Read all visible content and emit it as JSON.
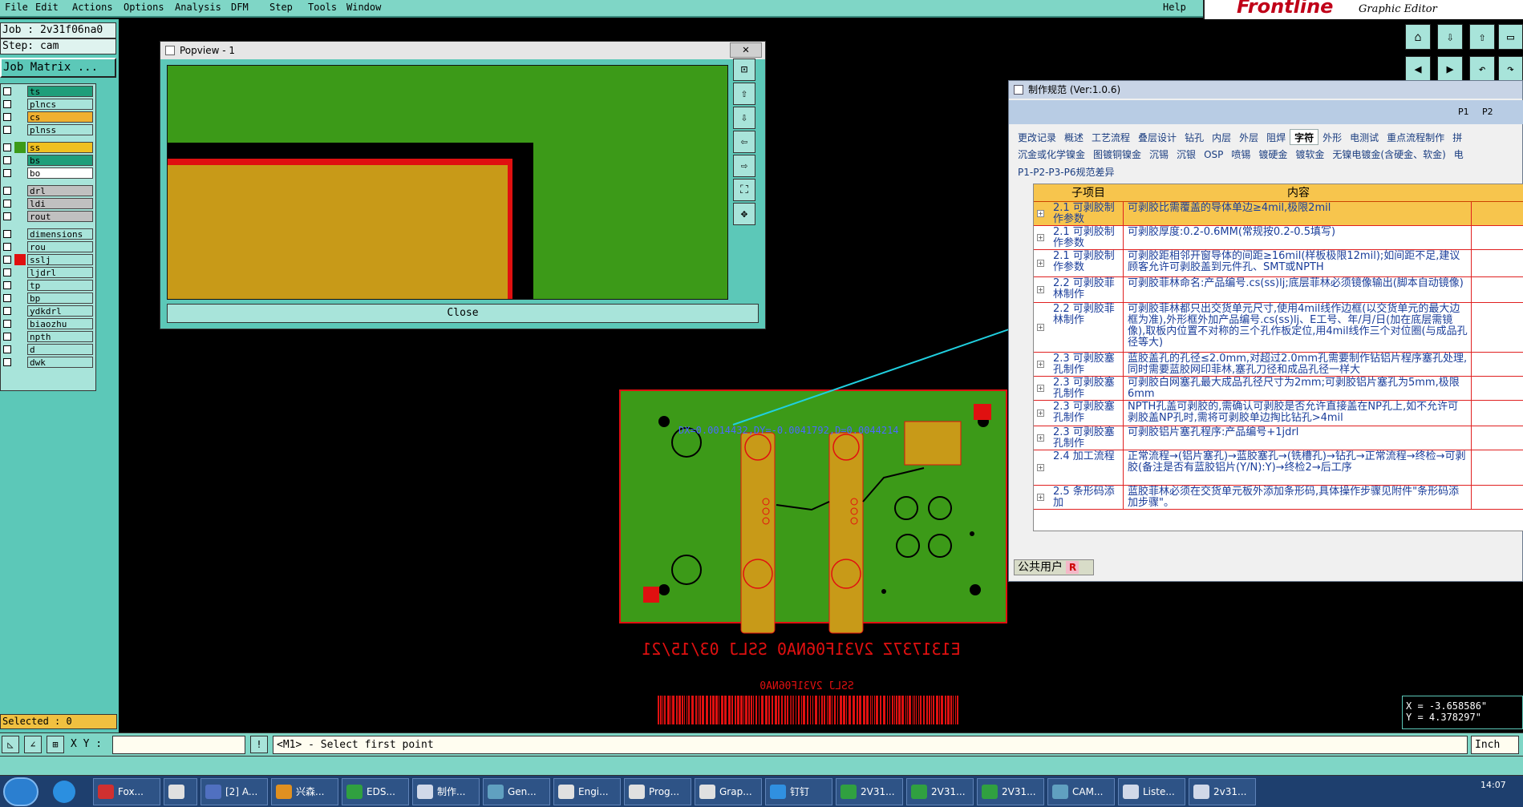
{
  "menubar": {
    "items": [
      "File",
      "Edit",
      "Actions",
      "Options",
      "Analysis",
      "DFM",
      "Step",
      "Tools",
      "Window"
    ],
    "help": "Help",
    "brand": "Frontline",
    "subtitle": "Graphic Editor"
  },
  "left_panel": {
    "job": "Job : 2v31f06na0",
    "step": "Step: cam",
    "job_matrix": "Job Matrix ...",
    "layers": [
      {
        "name": "ts",
        "color": "#1f9e7a"
      },
      {
        "name": "plncs",
        "color": "#a8e4da"
      },
      {
        "name": "cs",
        "color": "#f0b030"
      },
      {
        "name": "plnss",
        "color": "#a8e4da"
      },
      {
        "name": "ss",
        "color": "#f0c020"
      },
      {
        "name": "bs",
        "color": "#1f9e7a"
      },
      {
        "name": "bo",
        "color": "#ffffff"
      },
      {
        "name": "drl",
        "color": "#c0c0c0"
      },
      {
        "name": "ldi",
        "color": "#c0c0c0"
      },
      {
        "name": "rout",
        "color": "#c0c0c0"
      },
      {
        "name": "dimensions",
        "color": "#a8e4da"
      },
      {
        "name": "rou",
        "color": "#a8e4da"
      },
      {
        "name": "sslj",
        "color": "#a8e4da"
      },
      {
        "name": "ljdrl",
        "color": "#a8e4da"
      },
      {
        "name": "tp",
        "color": "#a8e4da"
      },
      {
        "name": "bp",
        "color": "#a8e4da"
      },
      {
        "name": "ydkdrl",
        "color": "#a8e4da"
      },
      {
        "name": "biaozhu",
        "color": "#a8e4da"
      },
      {
        "name": "npth",
        "color": "#a8e4da"
      },
      {
        "name": "d",
        "color": "#a8e4da"
      },
      {
        "name": "dwk",
        "color": "#a8e4da"
      }
    ],
    "selected": "Selected : 0"
  },
  "popview": {
    "title": "Popview - 1",
    "close_x": "✕",
    "close_button": "Close"
  },
  "measurement": {
    "text": "DX=0.0014432,DY=-0.0041792,D=0.0044214"
  },
  "board_text": {
    "mirrored_line": "E131737Z 2V31F06NA0 SSLJ 03/15/21",
    "small_line": "SSLJ 2V31F06NA0"
  },
  "spec": {
    "title": "制作规范 (Ver:1.0.6)",
    "filters": [
      "P1",
      "P2"
    ],
    "tabs_row1": [
      "更改记录",
      "概述",
      "工艺流程",
      "叠层设计",
      "钻孔",
      "内层",
      "外层",
      "阻焊",
      "字符",
      "外形",
      "电测试",
      "重点流程制作",
      "拼"
    ],
    "active_tab": "字符",
    "tabs_row2": [
      "沉金或化学镍金",
      "图镀铜镍金",
      "沉锡",
      "沉银",
      "OSP",
      "喷锡",
      "镀硬金",
      "镀软金",
      "无镍电镀金(含硬金、软金)",
      "电"
    ],
    "tab_row3": "P1-P2-P3-P6规范差异",
    "headers": [
      "子项目",
      "内容"
    ],
    "rows": [
      {
        "sub": "2.1 可剥胶制作参数",
        "content": "可剥胶比需覆盖的导体单边≥4mil,极限2mil",
        "selected": true
      },
      {
        "sub": "2.1 可剥胶制作参数",
        "content": "可剥胶厚度:0.2-0.6MM(常规按0.2-0.5填写)"
      },
      {
        "sub": "2.1 可剥胶制作参数",
        "content": "可剥胶距相邻开窗导体的间距≥16mil(样板极限12mil);如间距不足,建议顾客允许可剥胶盖到元件孔、SMT或NPTH"
      },
      {
        "sub": "2.2 可剥胶菲林制作",
        "content": "可剥胶菲林命名:产品编号.cs(ss)lj;底层菲林必须镜像输出(脚本自动镜像)"
      },
      {
        "sub": "2.2 可剥胶菲林制作",
        "content": "可剥胶菲林都只出交货单元尺寸,使用4mil线作边框(以交货单元的最大边框为准),外形框外加产品编号.cs(ss)lj、E工号、年/月/日(加在底层需镜像),取板内位置不对称的三个孔作板定位,用4mil线作三个对位圈(与成品孔径等大)"
      },
      {
        "sub": "2.3 可剥胶塞孔制作",
        "content": "蓝胶盖孔的孔径≤2.0mm,对超过2.0mm孔需要制作钻铝片程序塞孔处理,同时需要蓝胶网印菲林,塞孔刀径和成品孔径一样大"
      },
      {
        "sub": "2.3 可剥胶塞孔制作",
        "content": "可剥胶白网塞孔最大成品孔径尺寸为2mm;可剥胶铝片塞孔为5mm,极限6mm"
      },
      {
        "sub": "2.3 可剥胶塞孔制作",
        "content": "NPTH孔盖可剥胶的,需确认可剥胶是否允许直接盖在NP孔上,如不允许可剥胶盖NP孔时,需将可剥胶单边掏比钻孔>4mil"
      },
      {
        "sub": "2.3 可剥胶塞孔制作",
        "content": "可剥胶铝片塞孔程序:产品编号+1jdrl"
      },
      {
        "sub": "2.4 加工流程",
        "content": "正常流程→(铝片塞孔)→蓝胶塞孔→(铣槽孔)→钻孔→正常流程→终检→可剥胶(备注是否有蓝胶铝片(Y/N):Y)→终检2→后工序"
      },
      {
        "sub": "2.5 条形码添加",
        "content": "蓝胶菲林必须在交货单元板外添加条形码,具体操作步骤见附件\"条形码添加步骤\"。"
      }
    ],
    "footer": "公共用户",
    "footer_badge": "R"
  },
  "coords": {
    "x": "X = -3.658586\"",
    "y": "Y =  4.378297\""
  },
  "cmdbar": {
    "xy_label": "X Y :",
    "xy_value": "",
    "prompt": "<M1> - Select first point",
    "units": "Inch"
  },
  "taskbar": {
    "tasks": [
      {
        "label": "Fox...",
        "color": "#d03030"
      },
      {
        "label": "",
        "color": "#e0e0e0"
      },
      {
        "label": "[2] A...",
        "color": "#5070c0"
      },
      {
        "label": "兴森...",
        "color": "#e09020"
      },
      {
        "label": "EDS...",
        "color": "#30a040"
      },
      {
        "label": "制作...",
        "color": "#d0d8e8"
      },
      {
        "label": "Gen...",
        "color": "#60a0c0"
      },
      {
        "label": "Engi...",
        "color": "#e0e0e0"
      },
      {
        "label": "Prog...",
        "color": "#e0e0e0"
      },
      {
        "label": "Grap...",
        "color": "#e0e0e0"
      },
      {
        "label": "钉钉",
        "color": "#3090e0"
      },
      {
        "label": "2V31...",
        "color": "#30a040"
      },
      {
        "label": "2V31...",
        "color": "#30a040"
      },
      {
        "label": "2V31...",
        "color": "#30a040"
      },
      {
        "label": "CAM...",
        "color": "#60a0c0"
      },
      {
        "label": "Liste...",
        "color": "#d0d8e8"
      },
      {
        "label": "2v31...",
        "color": "#d0d8e8"
      }
    ],
    "clock": "14:07"
  },
  "colors": {
    "board_green": "#3c9a18",
    "pad_gold": "#c89a18",
    "outline_red": "#e01010",
    "measure_cyan": "#20d0e0"
  }
}
